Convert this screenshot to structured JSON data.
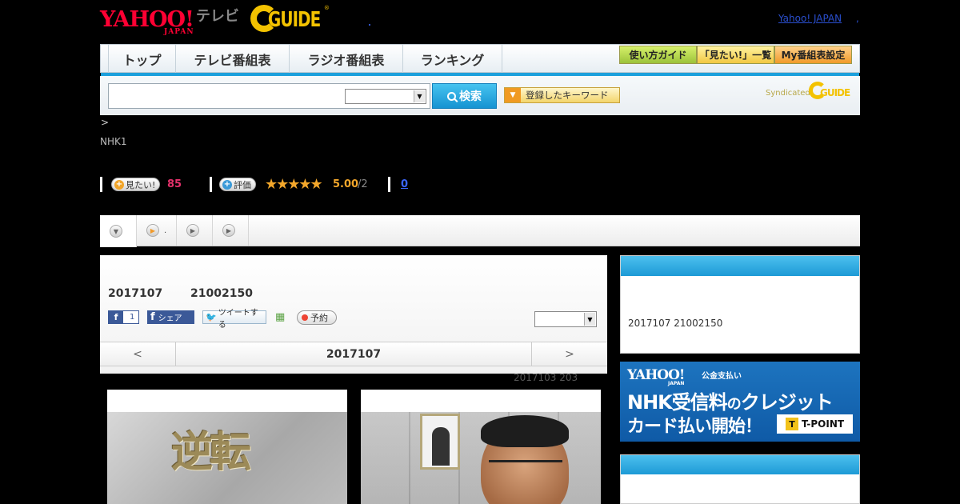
{
  "header": {
    "logo_yahoo": "YAHOO!",
    "logo_japan": "JAPAN",
    "logo_tv": "テレビ",
    "logo_gguide": "GUIDE",
    "logo_gguide_reg": "®",
    "yahoo_japan_link": "Yahoo! JAPAN",
    "link_separator": ","
  },
  "gnav": {
    "tabs": [
      {
        "label": "トップ"
      },
      {
        "label": "テレビ番組表"
      },
      {
        "label": "ラジオ番組表"
      },
      {
        "label": "ランキング"
      }
    ],
    "util": [
      {
        "label": "使い方ガイド",
        "color": "#9cc33a"
      },
      {
        "label": "「見たい!」一覧",
        "color": "#f2c842"
      },
      {
        "label": "My番組表設定",
        "color": "#f19a2a"
      }
    ]
  },
  "search": {
    "query": "",
    "select_value": "",
    "button_label": "検索",
    "keyword_button_label": "登録したキーワード",
    "syndicated_label": "Syndicated",
    "syndicated_logo": "GUIDE"
  },
  "program": {
    "breadcrumb_sep": ">",
    "channel": "NHK1",
    "mitai_label": "見たい!",
    "mitai_count": "85",
    "rate_label": "評価",
    "stars": "★★★★★",
    "score": "5.00",
    "score_den": "/2",
    "review_count": "0"
  },
  "tabs": {
    "items": [
      {
        "label": ""
      },
      {
        "label": "."
      },
      {
        "label": ""
      },
      {
        "label": ""
      }
    ]
  },
  "main": {
    "date": "2017107",
    "time": "21002150",
    "like_icon": "f",
    "like_count": "1",
    "share_label": "シェア",
    "tweet_label": "ツイートする",
    "reserve_label": "予約",
    "select_value": "",
    "pager_prev": "<",
    "pager_title": "2017107",
    "pager_next": ">",
    "replay": "2017103  203"
  },
  "sidebar": {
    "info": "2017107  21002150",
    "banner": {
      "yahoo": "YAHOO!",
      "japan": "JAPAN",
      "sub": "公金支払い",
      "line1a": "NHK受信料",
      "line1b": "の",
      "line1c": "クレジット",
      "line2": "カード払い開始！",
      "tpoint_icon": "T",
      "tpoint": "T-POINT"
    }
  },
  "thumbs": {
    "thumb1_title": "逆転"
  },
  "colors": {
    "accent_blue": "#1ca0dc",
    "pink": "#e5316b",
    "star": "#f3a72b",
    "link": "#2a4fcf"
  }
}
